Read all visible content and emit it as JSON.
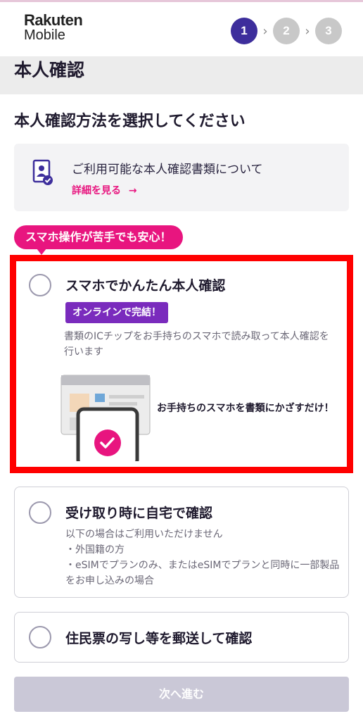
{
  "header": {
    "logo_line1": "Rakuten",
    "logo_line2": "Mobile",
    "steps": [
      "1",
      "2",
      "3"
    ],
    "active_step": 1
  },
  "page_title": "本人確認",
  "section_title": "本人確認方法を選択してください",
  "info_box": {
    "text": "ご利用可能な本人確認書類について",
    "link": "詳細を見る",
    "icon": "id-document-check-icon"
  },
  "bubble": "スマホ操作が苦手でも安心！",
  "options": [
    {
      "title": "スマホでかんたん本人確認",
      "badge": "オンラインで完結！",
      "description": "書類のICチップをお手持ちのスマホで読み取って本人確認を行います",
      "caption": "お手持ちのスマホを書類にかざすだけ！"
    },
    {
      "title": "受け取り時に自宅で確認",
      "description_lines": [
        "以下の場合はご利用いただけません",
        "・外国籍の方",
        "・eSIMでプランのみ、またはeSIMでプランと同時に一部製品をお申し込みの場合"
      ]
    },
    {
      "title": "住民票の写し等を郵送して確認"
    }
  ],
  "next_button": "次へ進む",
  "colors": {
    "accent_pink": "#e8157f",
    "brand_navy": "#3d2e9c",
    "badge_purple": "#7a2bbd",
    "highlight_red": "#ff0000",
    "disabled_button": "#cac8d7"
  }
}
